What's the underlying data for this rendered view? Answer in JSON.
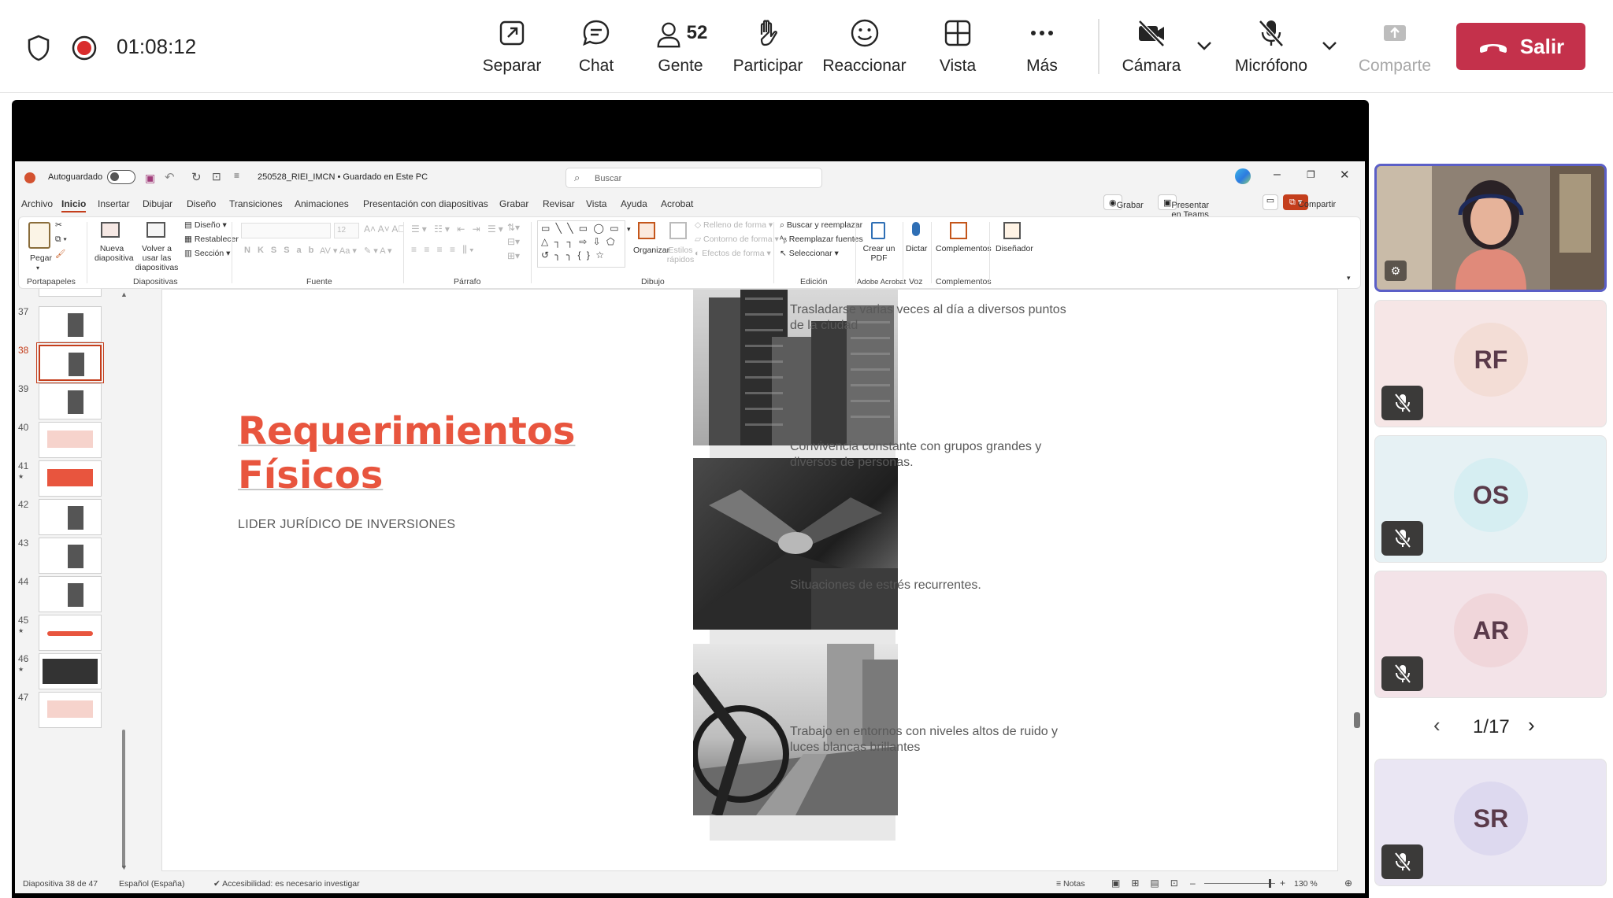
{
  "meeting": {
    "timer": "01:08:12",
    "toolbar": [
      {
        "id": "separar",
        "label": "Separar",
        "icon": "popout-icon"
      },
      {
        "id": "chat",
        "label": "Chat",
        "icon": "chat-icon"
      },
      {
        "id": "gente",
        "label": "Gente",
        "icon": "people-icon",
        "count": "52"
      },
      {
        "id": "participar",
        "label": "Participar",
        "icon": "raise-hand-icon"
      },
      {
        "id": "reaccionar",
        "label": "Reaccionar",
        "icon": "smiley-icon"
      },
      {
        "id": "vista",
        "label": "Vista",
        "icon": "grid-icon"
      },
      {
        "id": "mas",
        "label": "Más",
        "icon": "more-icon"
      }
    ],
    "camera_label": "Cámara",
    "mic_label": "Micrófono",
    "share_label": "Comparte",
    "leave_label": "Salir",
    "colors": {
      "leave": "#c4314b",
      "accent": "#5b5fc7"
    }
  },
  "powerpoint": {
    "autosave_label": "Autoguardado",
    "filename": "250528_RIEI_IMCN • Guardado en Este PC",
    "search_placeholder": "Buscar",
    "tabs": [
      "Archivo",
      "Inicio",
      "Insertar",
      "Dibujar",
      "Diseño",
      "Transiciones",
      "Animaciones",
      "Presentación con diapositivas",
      "Grabar",
      "Revisar",
      "Vista",
      "Ayuda",
      "Acrobat"
    ],
    "active_tab": "Inicio",
    "right_buttons": {
      "record": "Grabar",
      "present": "Presentar en Teams",
      "share": "Compartir"
    },
    "ribbon": {
      "clipboard": {
        "paste": "Pegar",
        "group": "Portapapeles"
      },
      "slides": {
        "new": "Nueva diapositiva",
        "reuse": "Volver a usar las diapositivas",
        "layout": "Diseño",
        "reset": "Restablecer",
        "section": "Sección",
        "group": "Diapositivas"
      },
      "font": {
        "size": "12",
        "group": "Fuente"
      },
      "paragraph": {
        "group": "Párrafo"
      },
      "drawing": {
        "arrange": "Organizar",
        "quick_styles": "Estilos rápidos",
        "fill": "Relleno de forma",
        "outline": "Contorno de forma",
        "effects": "Efectos de forma",
        "group": "Dibujo"
      },
      "editing": {
        "find": "Buscar y reemplazar",
        "replace_fonts": "Reemplazar fuentes",
        "select": "Seleccionar",
        "group": "Edición"
      },
      "acrobat": {
        "create": "Crear un PDF",
        "group": "Adobe Acrobat"
      },
      "voice": {
        "dictate": "Dictar",
        "group": "Voz"
      },
      "addins": {
        "label": "Complementos",
        "group": "Complementos"
      },
      "designer": {
        "label": "Diseñador"
      }
    },
    "thumbnails": [
      {
        "num": "37",
        "star": ""
      },
      {
        "num": "38",
        "star": "",
        "active": true
      },
      {
        "num": "39",
        "star": ""
      },
      {
        "num": "40",
        "star": ""
      },
      {
        "num": "41",
        "star": "★"
      },
      {
        "num": "42",
        "star": ""
      },
      {
        "num": "43",
        "star": ""
      },
      {
        "num": "44",
        "star": ""
      },
      {
        "num": "45",
        "star": "★"
      },
      {
        "num": "46",
        "star": "★"
      },
      {
        "num": "47",
        "star": ""
      }
    ],
    "slide": {
      "title_line1": "Requerimientos",
      "title_line2": "Físicos",
      "subtitle": "LIDER JURÍDICO DE INVERSIONES",
      "items": [
        "Trasladarse varias veces al día a diversos puntos de la ciudad",
        "Convivencia constante con grupos grandes y diversos de personas.",
        "Situaciones de estrés recurrentes.",
        "Trabajo en entornos con niveles altos de ruido y luces blancas  brillantes"
      ],
      "title_color": "#e8553e"
    },
    "status": {
      "slide_of": "Diapositiva 38 de 47",
      "language": "Español (España)",
      "accessibility": "Accesibilidad: es necesario investigar",
      "notes": "Notas",
      "zoom": "130 %"
    }
  },
  "participants": {
    "tiles": [
      {
        "initials": "RF",
        "bg": "#f6e6e6",
        "circle": "#f3ddd6"
      },
      {
        "initials": "OS",
        "bg": "#e6f1f4",
        "circle": "#d6eef2"
      },
      {
        "initials": "AR",
        "bg": "#f3e3e8",
        "circle": "#f0d6da"
      },
      {
        "initials": "SR",
        "bg": "#eae6f3",
        "circle": "#ddd9ef"
      }
    ],
    "page": "1/17"
  }
}
